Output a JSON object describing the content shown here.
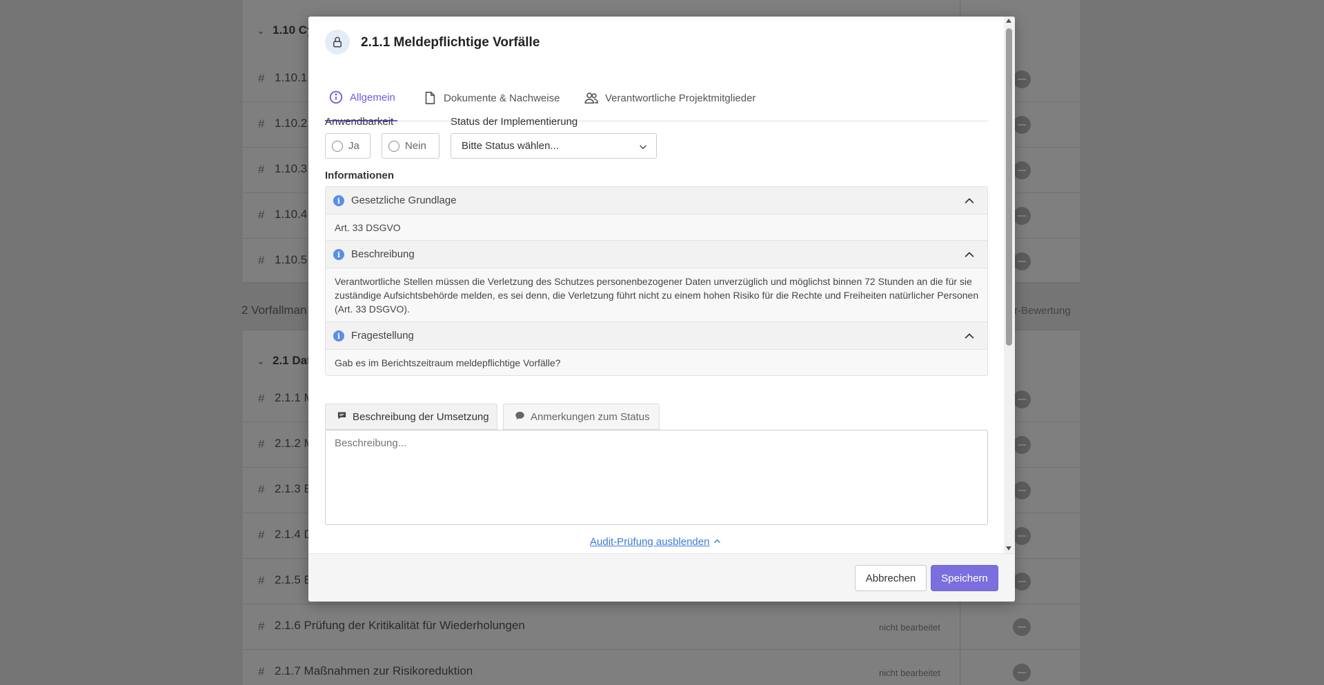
{
  "background": {
    "groups": [
      {
        "label": "1.10 Cy"
      },
      {
        "label": "2.1 Dat"
      }
    ],
    "rows_110": [
      {
        "num": "1.10.1"
      },
      {
        "num": "1.10.2"
      },
      {
        "num": "1.10.3"
      },
      {
        "num": "1.10.4"
      },
      {
        "num": "1.10.5"
      }
    ],
    "section_label": "2 Vorfallman",
    "section_right": "r-Bewertung",
    "rows_21": [
      {
        "num": "2.1.1 M",
        "state": ""
      },
      {
        "num": "2.1.2 M",
        "state": ""
      },
      {
        "num": "2.1.3 E",
        "state": ""
      },
      {
        "num": "2.1.4 D",
        "state": ""
      },
      {
        "num": "2.1.5 E",
        "state": ""
      },
      {
        "num": "2.1.6 Prüfung der Kritikalität für Wiederholungen",
        "state": "nicht bearbeitet"
      },
      {
        "num": "2.1.7 Maßnahmen zur Risikoreduktion",
        "state": "nicht bearbeitet"
      }
    ]
  },
  "modal": {
    "title": "2.1.1 Meldepflichtige Vorfälle",
    "title_icon": "lock-icon",
    "tabs": [
      {
        "label": "Allgemein",
        "icon": "info-icon",
        "active": true
      },
      {
        "label": "Dokumente & Nachweise",
        "icon": "document-icon",
        "active": false
      },
      {
        "label": "Verantwortliche Projektmitglieder",
        "icon": "users-icon",
        "active": false
      }
    ],
    "applicability": {
      "label": "Anwendbarkeit",
      "options": [
        "Ja",
        "Nein"
      ]
    },
    "status": {
      "label": "Status der Implementierung",
      "selected": "Bitte Status wählen..."
    },
    "info": {
      "heading": "Informationen",
      "sections": [
        {
          "title": "Gesetzliche Grundlage",
          "body": "Art. 33 DSGVO"
        },
        {
          "title": "Beschreibung",
          "body": "Verantwortliche Stellen müssen die Verletzung des Schutzes personenbezogener Daten unverzüglich und möglichst binnen 72 Stunden an die für sie zuständige Aufsichtsbehörde melden, es sei denn, die Verletzung führt nicht zu einem hohen Risiko für die Rechte und Freiheiten natürlicher Personen (Art. 33 DSGVO)."
        },
        {
          "title": "Fragestellung",
          "body": "Gab es im Berichtszeitraum meldepflichtige Vorfälle?"
        }
      ]
    },
    "text_tabs": [
      {
        "label": "Beschreibung der Umsetzung",
        "active": true
      },
      {
        "label": "Anmerkungen zum Status",
        "active": false
      }
    ],
    "textarea_placeholder": "Beschreibung...",
    "audit_link": "Audit-Prüfung ausblenden",
    "footer": {
      "cancel": "Abbrechen",
      "save": "Speichern"
    },
    "accent_color": "#6a5be0"
  }
}
